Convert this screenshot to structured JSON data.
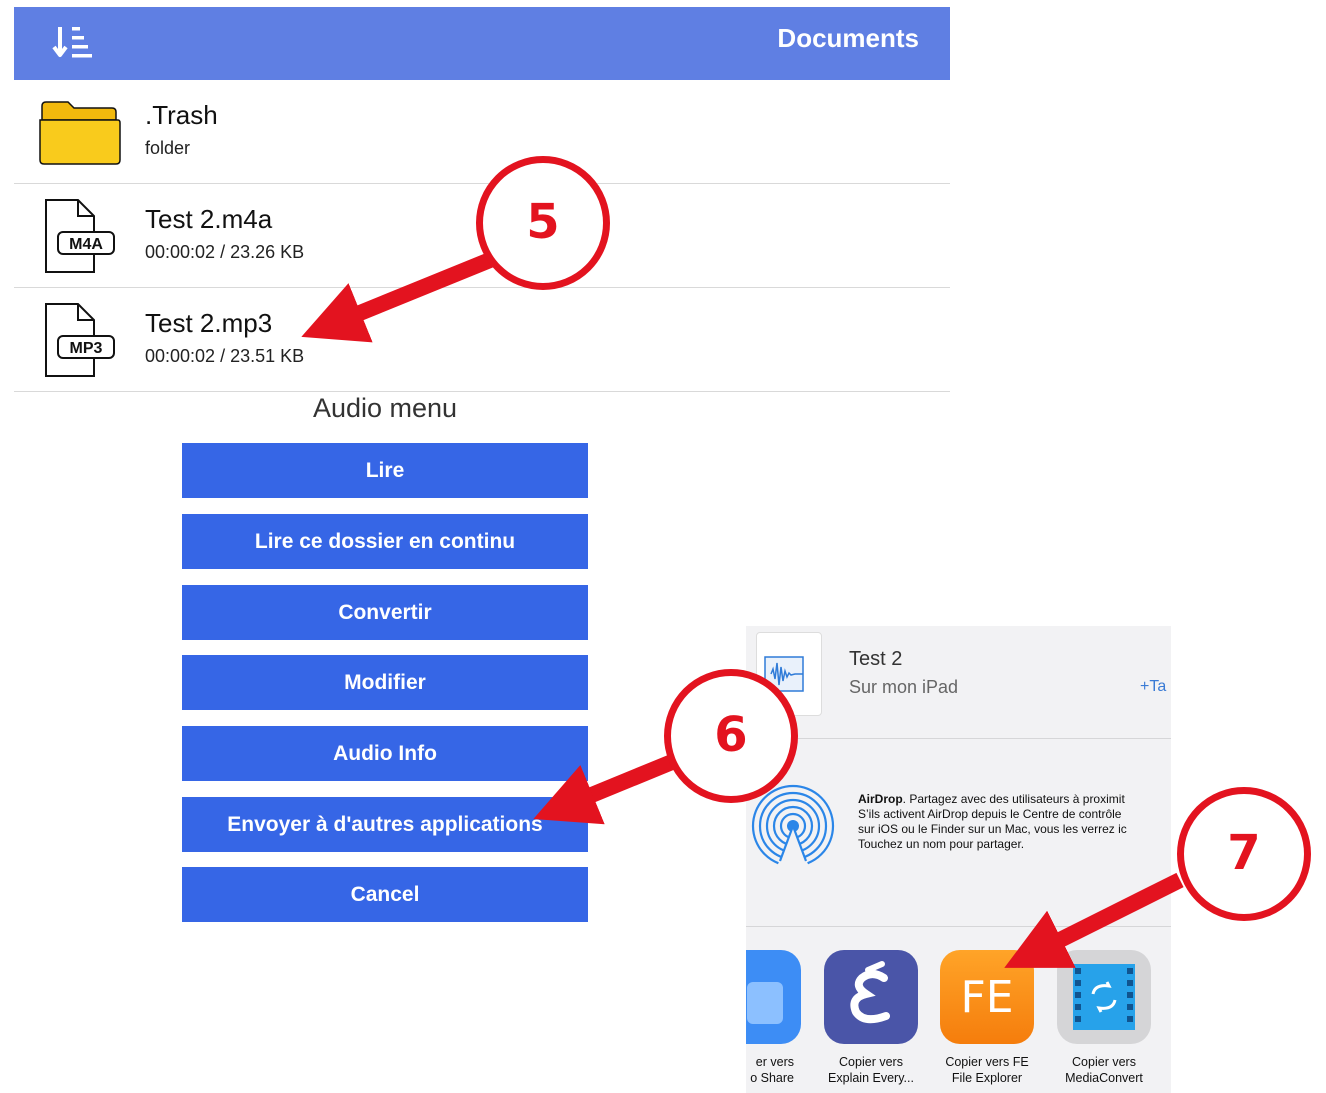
{
  "header": {
    "title": "Documents",
    "sort_icon": "sort-descending-icon"
  },
  "files": [
    {
      "name": ".Trash",
      "sub": "folder",
      "icon": "folder-icon"
    },
    {
      "name": "Test 2.m4a",
      "sub": "00:00:02 / 23.26 KB",
      "icon": "m4a-file-icon",
      "badge": "M4A"
    },
    {
      "name": "Test 2.mp3",
      "sub": "00:00:02 / 23.51 KB",
      "icon": "mp3-file-icon",
      "badge": "MP3"
    }
  ],
  "audio_menu": {
    "title": "Audio menu",
    "buttons": [
      "Lire",
      "Lire ce dossier en continu",
      "Convertir",
      "Modifier",
      "Audio Info",
      "Envoyer à d'autres applications",
      "Cancel"
    ]
  },
  "share_sheet": {
    "doc_title": "Test 2",
    "doc_sub": "Sur mon iPad",
    "tags": "+Ta",
    "airdrop": {
      "bold": "AirDrop",
      "line1": ". Partagez avec des utilisateurs à proximit",
      "line2": "S’ils activent AirDrop depuis le Centre de contrôle",
      "line3": "sur iOS ou le Finder sur un Mac, vous les verrez ic",
      "line4": "Touchez un nom pour partager."
    },
    "apps": [
      {
        "line1": "er vers",
        "line2": "o Share"
      },
      {
        "line1": "Copier vers",
        "line2": "Explain Every..."
      },
      {
        "line1": "Copier vers FE",
        "line2": "File Explorer",
        "tile_text": "FE"
      },
      {
        "line1": "Copier vers",
        "line2": "MediaConvert"
      }
    ]
  },
  "annotations": {
    "step5": "5",
    "step6": "6",
    "step7": "7"
  },
  "colors": {
    "header": "#5f7fe3",
    "button": "#3666e6",
    "annotation": "#e3131f",
    "folder": "#f7c515"
  }
}
